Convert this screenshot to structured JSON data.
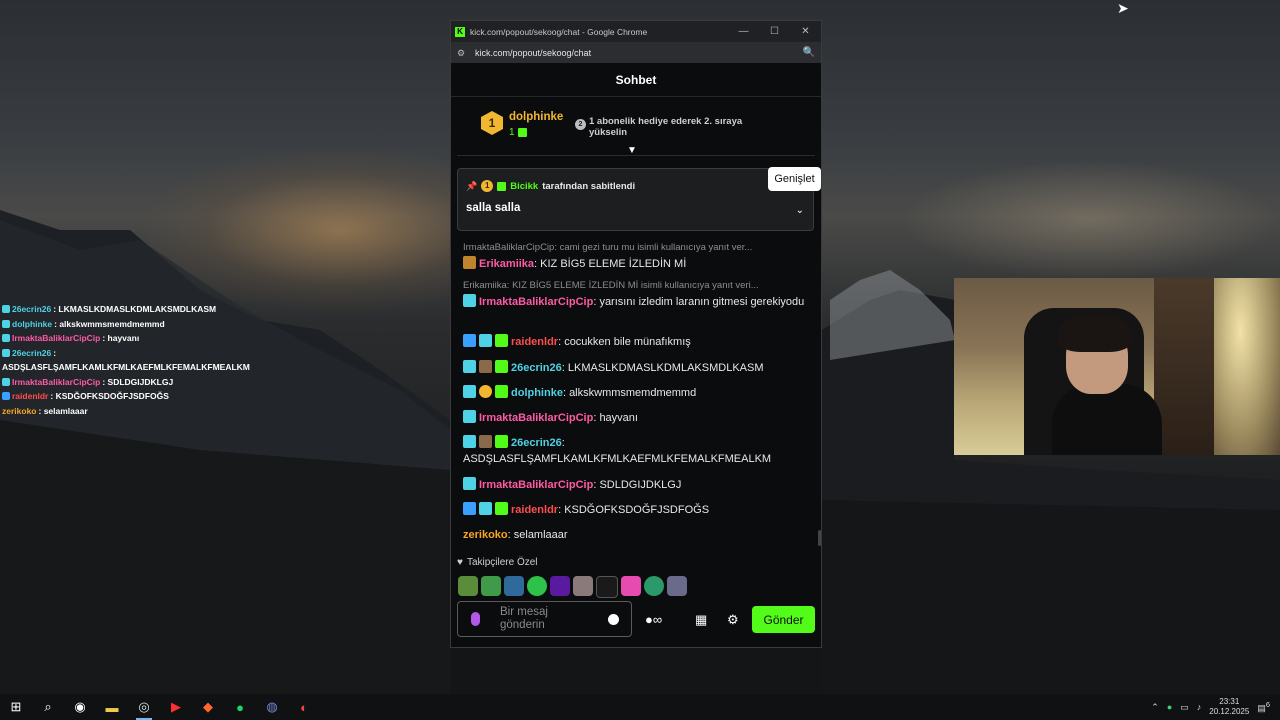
{
  "desktop_overlay": [
    {
      "user": "26ecrin26",
      "color": "#4fd1e6",
      "text": ": LKMASLKDMASLKDMLAKSMDLKASM"
    },
    {
      "user": "dolphinke",
      "color": "#4fd1e6",
      "text": ": alkskwmmsmemdmemmd"
    },
    {
      "user": "IrmaktaBaliklarCipCip",
      "color": "#ff5aa5",
      "text": ": hayvanı"
    },
    {
      "user": "26ecrin26",
      "color": "#4fd1e6",
      "text": ":"
    },
    {
      "user": "",
      "color": "#ffffff",
      "text": "ASDŞLASFLŞAMFLKAMLKFMLKAEFMLKFEMALKFMEALKM"
    },
    {
      "user": "IrmaktaBaliklarCipCip",
      "color": "#ff5aa5",
      "text": ": SDLDGIJDKLGJ"
    },
    {
      "user": "raidenldr",
      "color": "#ff4d4d",
      "text": ": KSDĞOFKSDOĞFJSDFOĞS"
    },
    {
      "user": "zerikoko",
      "color": "#f5a623",
      "text": ": selamlaaar"
    }
  ],
  "window": {
    "title": "kick.com/popout/sekoog/chat - Google Chrome",
    "favicon": "K",
    "url": "kick.com/popout/sekoog/chat",
    "minimize": "—",
    "maximize": "☐",
    "close": "✕"
  },
  "chat": {
    "header": "Sohbet",
    "leaderboard": {
      "rank": "1",
      "name": "dolphinke",
      "count": "1",
      "rank2": "2",
      "promo": "1 abonelik hediye ederek 2. sıraya yükselin"
    },
    "pinned": {
      "coin": "1",
      "user": "Bicikk",
      "by_text": "tarafından sabitlendi",
      "message": "salla salla",
      "tooltip": "Genişlet"
    },
    "messages": [
      {
        "reply": "IrmaktaBaliklarCipCip: cami gezi turu mu isimli kullanıcıya yanıt ver...",
        "user": "Erikamiika",
        "color": "#ff5aa5",
        "text": ": KIZ BİG5 ELEME İZLEDİN Mİ"
      },
      {
        "reply": "Erikamiika: KIZ BİG5 ELEME İZLEDİN Mİ isimli kullanıcıya yanıt veri...",
        "user": "IrmaktaBaliklarCipCip",
        "color": "#ff5aa5",
        "text": ": yarısını izledim laranın gitmesi gerekiyodu"
      },
      {
        "user": "raidenldr",
        "color": "#ff4d4d",
        "text": ": cocukken bile münafıkmış"
      },
      {
        "user": "26ecrin26",
        "color": "#4fd1e6",
        "text": ": LKMASLKDMASLKDMLAKSMDLKASM"
      },
      {
        "user": "dolphinke",
        "color": "#4fd1e6",
        "text": ": alkskwmmsmemdmemmd"
      },
      {
        "user": "IrmaktaBaliklarCipCip",
        "color": "#ff5aa5",
        "text": ": hayvanı"
      },
      {
        "user": "26ecrin26",
        "color": "#4fd1e6",
        "text": ": ASDŞLASFLŞAMFLKAMLKFMLKAEFMLKFEMALKFMEALKM"
      },
      {
        "user": "IrmaktaBaliklarCipCip",
        "color": "#ff5aa5",
        "text": ": SDLDGIJDKLGJ"
      },
      {
        "user": "raidenldr",
        "color": "#ff4d4d",
        "text": ": KSDĞOFKSDOĞFJSDFOĞS"
      },
      {
        "user": "zerikoko",
        "color": "#f5a623",
        "text": ": selamlaaar"
      }
    ],
    "followers_label": "Takipçilere Özel",
    "input_placeholder": "Bir mesaj gönderin",
    "send_label": "Gönder"
  },
  "taskbar": {
    "time": "23:31",
    "date": "20.12.2025",
    "notif_count": "6"
  },
  "colors": {
    "kick_green": "#53fc18",
    "gold": "#f2b731"
  }
}
